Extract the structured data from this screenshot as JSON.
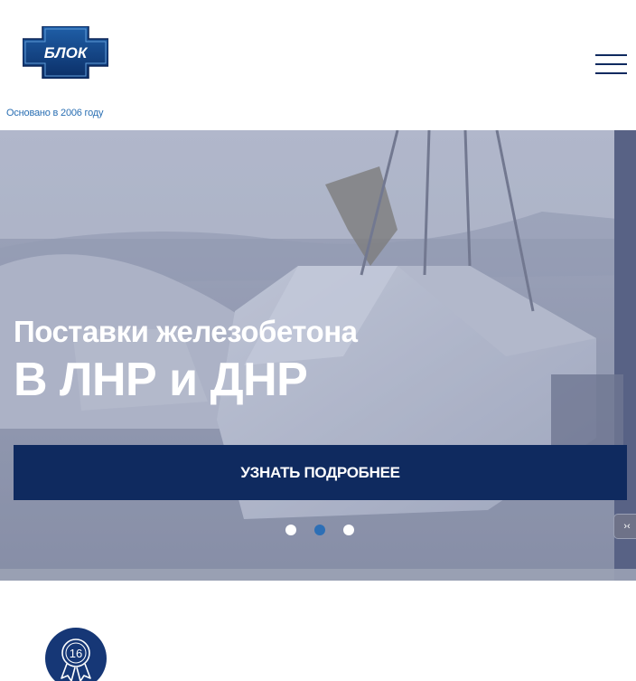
{
  "header": {
    "logo_text": "БЛОК",
    "tagline": "Основано в 2006 году",
    "menu_icon": "hamburger-menu-icon"
  },
  "hero": {
    "subtitle": "Поставки железобетона",
    "title": "В ЛНР и ДНР",
    "cta_label": "УЗНАТЬ ПОДРОБНЕЕ",
    "slides_total": 3,
    "active_slide": 2
  },
  "widget": {
    "icon": "chat-widget-icon",
    "glyph": "›‹"
  },
  "badge": {
    "number": "16",
    "icon": "award-ribbon-icon"
  },
  "colors": {
    "brand_navy": "#0f2a5f",
    "accent_blue": "#2d6fb6",
    "tagline_blue": "#2a6fb3",
    "badge_navy": "#163776"
  }
}
